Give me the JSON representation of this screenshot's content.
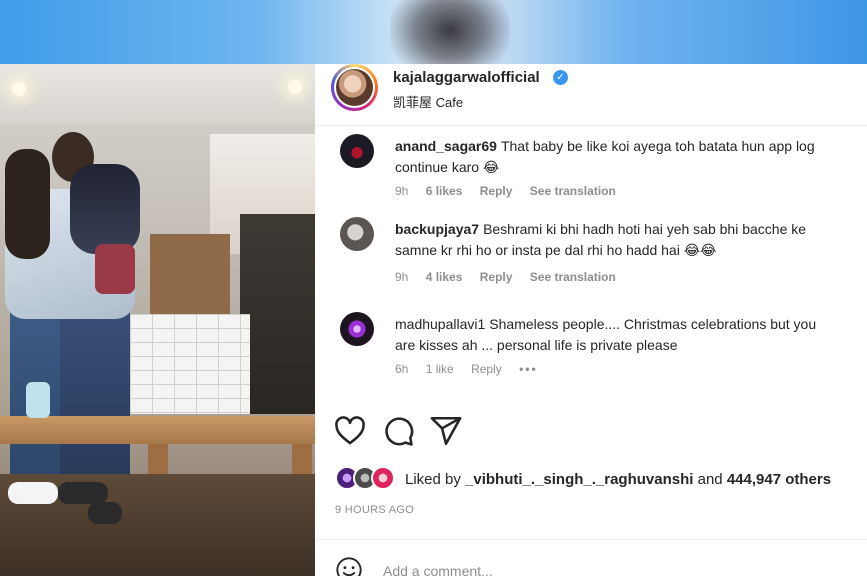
{
  "post": {
    "username": "kajalaggarwalofficial",
    "location": "凯菲屋 Cafe"
  },
  "comments": [
    {
      "user": "anand_sagar69",
      "text": "That baby be like koi ayega toh batata hun app log continue karo 😂",
      "time": "9h",
      "likes": "6 likes",
      "reply": "Reply",
      "translate": "See translation"
    },
    {
      "user": "backupjaya7",
      "text": "Beshrami ki bhi hadh hoti hai yeh sab bhi bacche ke samne kr rhi ho or insta pe dal rhi ho hadd hai 😂😂",
      "time": "9h",
      "likes": "4 likes",
      "reply": "Reply",
      "translate": "See translation"
    },
    {
      "user": "madhupallavi1",
      "text": "Shameless people.... Christmas celebrations but you are kisses ah ... personal life is private please",
      "time": "6h",
      "likes": "1 like",
      "reply": "Reply",
      "more": "•••"
    }
  ],
  "likes": {
    "prefix": "Liked by",
    "user": "_vibhuti_._singh_._raghuvanshi",
    "connector": "and",
    "count": "444,947 others"
  },
  "timestamp": "9 HOURS AGO",
  "add_comment": {
    "placeholder": "Add a comment..."
  },
  "icons": {
    "like": "heart-icon",
    "comment": "comment-icon",
    "share": "send-icon",
    "emoji": "emoji-icon",
    "verified": "verified-badge-icon"
  },
  "colors": {
    "verified": "#3897f0",
    "muted": "#8e8e8e",
    "text": "#262626"
  }
}
